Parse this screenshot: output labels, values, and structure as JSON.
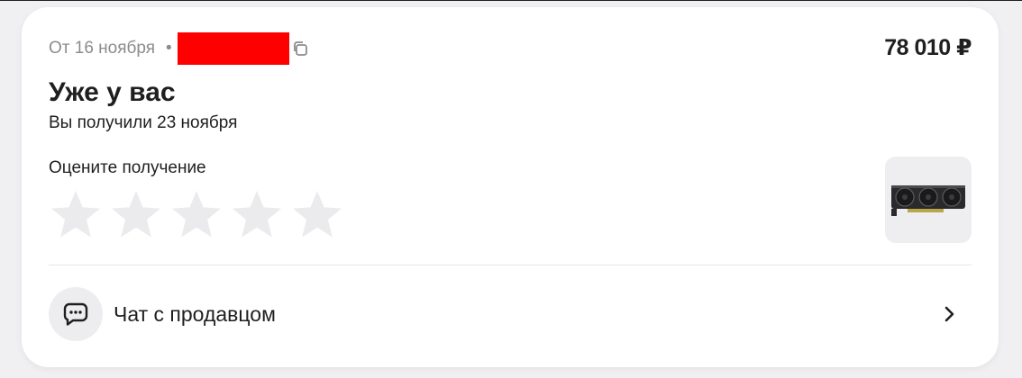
{
  "order": {
    "date_text": "От 16 ноября",
    "separator": "•",
    "price": "78 010 ₽",
    "status_title": "Уже у вас",
    "received_text": "Вы получили 23 ноября"
  },
  "rating": {
    "label": "Оцените получение",
    "stars_total": 5,
    "stars_selected": 0
  },
  "chat": {
    "label": "Чат с продавцом"
  },
  "icons": {
    "copy": "copy-icon",
    "star": "star-icon",
    "chat": "chat-bubble-icon",
    "chevron": "chevron-right-icon",
    "product": "graphics-card-icon"
  },
  "colors": {
    "card_bg": "#ffffff",
    "page_bg": "#f0f0f3",
    "muted_text": "#8c8c90",
    "star_empty": "#ebebed",
    "redaction": "#ff0000"
  }
}
